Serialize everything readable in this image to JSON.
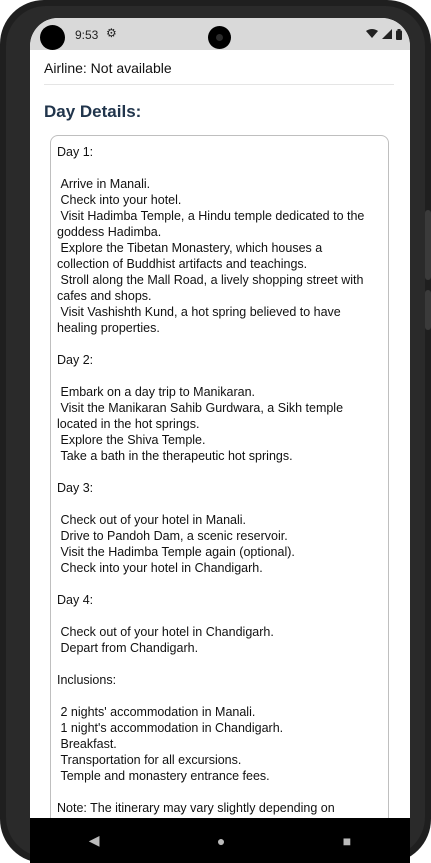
{
  "status_bar": {
    "time": "9:53",
    "icons": [
      "settings-icon",
      "wifi-icon",
      "signal-icon",
      "battery-icon"
    ]
  },
  "header": {
    "airline": "Airline: Not available"
  },
  "section": {
    "title": "Day Details:"
  },
  "details": {
    "text": "Day 1:\n\n Arrive in Manali.\n Check into your hotel.\n Visit Hadimba Temple, a Hindu temple dedicated to the goddess Hadimba.\n Explore the Tibetan Monastery, which houses a collection of Buddhist artifacts and teachings.\n Stroll along the Mall Road, a lively shopping street with cafes and shops.\n Visit Vashishth Kund, a hot spring believed to have healing properties.\n\nDay 2:\n\n Embark on a day trip to Manikaran.\n Visit the Manikaran Sahib Gurdwara, a Sikh temple located in the hot springs.\n Explore the Shiva Temple.\n Take a bath in the therapeutic hot springs.\n\nDay 3:\n\n Check out of your hotel in Manali.\n Drive to Pandoh Dam, a scenic reservoir.\n Visit the Hadimba Temple again (optional).\n Check into your hotel in Chandigarh.\n\nDay 4:\n\n Check out of your hotel in Chandigarh.\n Depart from Chandigarh.\n\nInclusions:\n\n 2 nights' accommodation in Manali.\n 1 night's accommodation in Chandigarh.\n Breakfast.\n Transportation for all excursions.\n Temple and monastery entrance fees.\n\nNote: The itinerary may vary slightly depending on availability and weather conditions."
  },
  "navigation": {
    "back_glyph": "◀",
    "home_glyph": "●",
    "recents_glyph": "■"
  }
}
